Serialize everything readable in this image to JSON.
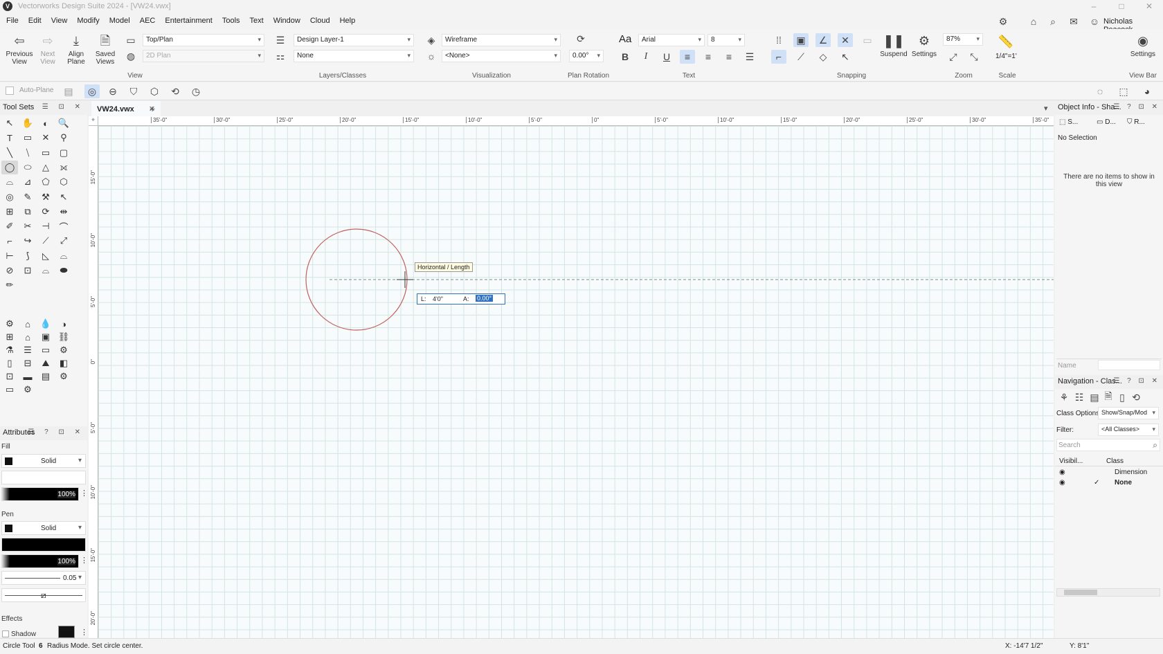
{
  "window": {
    "title": "Vectorworks Design Suite 2024 - [VW24.vwx]",
    "minimize": "–",
    "maximize": "□",
    "close": "✕"
  },
  "menu": [
    "File",
    "Edit",
    "View",
    "Modify",
    "Model",
    "AEC",
    "Entertainment",
    "Tools",
    "Text",
    "Window",
    "Cloud",
    "Help"
  ],
  "user": {
    "name": "Nicholas Peacock"
  },
  "ribbon": {
    "view": {
      "previous_view": "Previous View",
      "next_view": "Next View",
      "align_plane": "Align Plane",
      "saved_views": "Saved Views",
      "view_combo": "Top/Plan",
      "render_combo": "2D Plan",
      "label": "View"
    },
    "layers": {
      "layer_combo": "Design Layer-1",
      "class_combo": "None",
      "label": "Layers/Classes"
    },
    "visualization": {
      "render_mode": "Wireframe",
      "light_combo": "<None>",
      "label": "Visualization"
    },
    "plan_rotation": {
      "value": "0.00°",
      "label": "Plan Rotation"
    },
    "text": {
      "font_prefix": "Aa",
      "font": "Arial",
      "size": "8",
      "bold": "B",
      "italic": "I",
      "underline": "U",
      "label": "Text"
    },
    "snapping": {
      "suspend": "Suspend",
      "settings": "Settings",
      "label": "Snapping"
    },
    "zoom": {
      "value": "87%",
      "label": "Zoom"
    },
    "scale": {
      "value": "1/4\"=1'",
      "label": "Scale"
    },
    "viewbar": {
      "settings": "Settings",
      "label": "View Bar"
    }
  },
  "toolbar2": {
    "auto_plane": "Auto-Plane"
  },
  "toolsets": {
    "title": "Tool Sets"
  },
  "attributes": {
    "title": "Attributes",
    "fill_label": "Fill",
    "fill_style": "Solid",
    "fill_opacity": "100%",
    "pen_label": "Pen",
    "pen_style": "Solid",
    "pen_opacity": "100%",
    "line_weight": "0.05",
    "effects_label": "Effects",
    "shadow_label": "Shadow"
  },
  "document": {
    "tab": "VW24.vwx",
    "tab_add": "+",
    "hruler_ticks": [
      "35'-0\"",
      "30'-0\"",
      "25'-0\"",
      "20'-0\"",
      "15'-0\"",
      "10'-0\"",
      "5'-0\"",
      "0\"",
      "5'-0\"",
      "10'-0\"",
      "15'-0\"",
      "20'-0\"",
      "25'-0\"",
      "30'-0\"",
      "35'-0\""
    ],
    "vruler_ticks": [
      "15'-0\"",
      "10'-0\"",
      "5'-0\"",
      "0\"",
      "5'-0\"",
      "10'-0\"",
      "15'-0\"",
      "20'-0\""
    ],
    "tooltip": "Horizontal / Length",
    "databar": {
      "l_label": "L:",
      "l_value": "4'0\"",
      "a_label": "A:",
      "a_value": "0.00°"
    }
  },
  "object_info": {
    "title": "Object Info - Sha...",
    "tab_shape": "S...",
    "tab_data": "D...",
    "tab_render": "R...",
    "selection": "No Selection",
    "empty_message": "There are no items to show in this view",
    "name_label": "Name"
  },
  "navigation": {
    "title": "Navigation - Clas...",
    "class_options_label": "Class Options",
    "class_options_value": "Show/Snap/Mod",
    "filter_label": "Filter:",
    "filter_value": "<All Classes>",
    "search_placeholder": "Search",
    "col_visibility": "Visibil...",
    "col_class": "Class",
    "rows": [
      {
        "name": "Dimension",
        "active": ""
      },
      {
        "name": "None",
        "active": "✓"
      }
    ]
  },
  "status": {
    "tool": "Circle Tool",
    "mode_num": "6",
    "message": "Radius Mode. Set circle center.",
    "x": "X: -14'7 1/2\"",
    "y": "Y: 8'1\""
  },
  "colors": {
    "circle": "#c06060",
    "accent": "#3070c0"
  }
}
